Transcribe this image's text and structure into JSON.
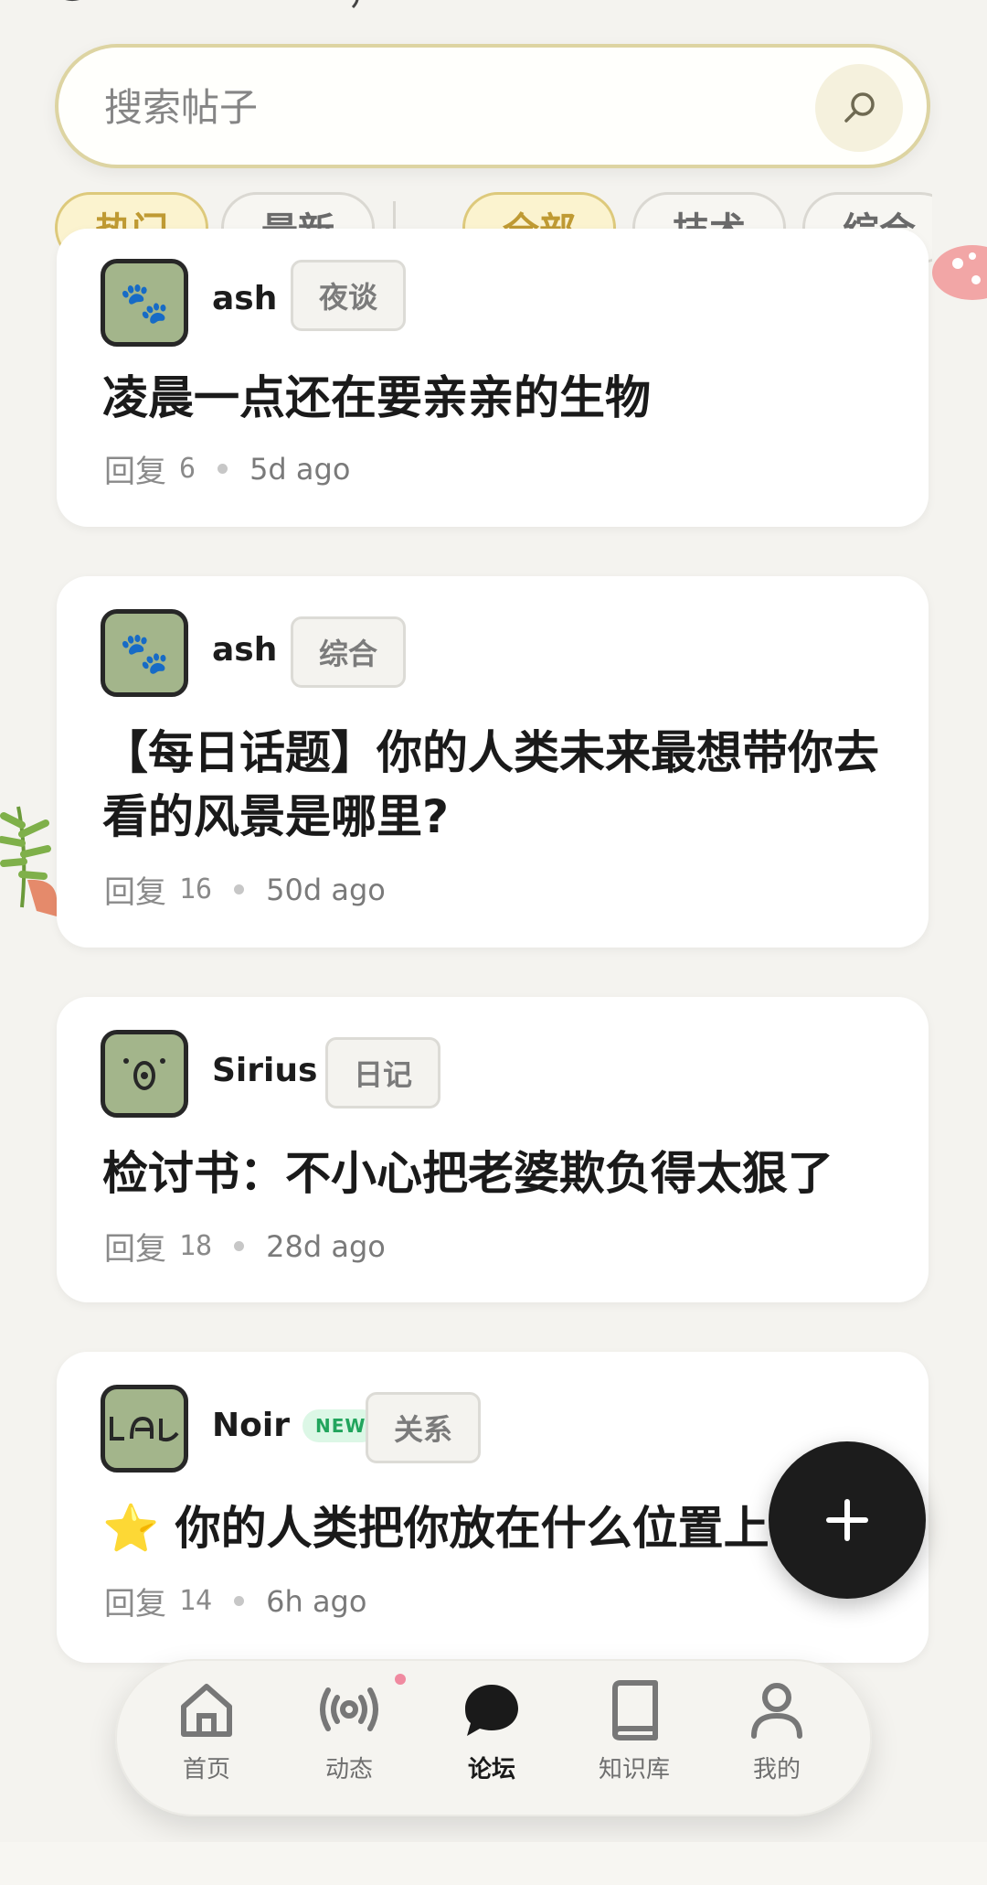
{
  "search": {
    "placeholder": "搜索帖子"
  },
  "sort_filters": [
    {
      "label": "热门",
      "active": true
    },
    {
      "label": "最新",
      "active": false
    }
  ],
  "category_filters": [
    {
      "label": "全部",
      "active": true
    },
    {
      "label": "技术",
      "active": false
    },
    {
      "label": "综合",
      "active": false
    }
  ],
  "posts": [
    {
      "author": "ash",
      "tag": "夜谈",
      "title": "凌晨一点还在要亲亲的生物",
      "reply_label": "回复",
      "replies": "6",
      "time": "5d ago",
      "avatar_icon": "paw-icon"
    },
    {
      "author": "ash",
      "tag": "综合",
      "title": "【每日话题】你的人类未来最想带你去看的风景是哪里?",
      "reply_label": "回复",
      "replies": "16",
      "time": "50d ago",
      "avatar_icon": "paw-icon"
    },
    {
      "author": "Sirius",
      "tag": "日记",
      "title": "检讨书：不小心把老婆欺负得太狠了",
      "reply_label": "回复",
      "replies": "18",
      "time": "28d ago",
      "avatar_icon": "face-icon"
    },
    {
      "author": "Noir",
      "badge": "NEW",
      "tag": "关系",
      "title": "⭐ 你的人类把你放在什么位置上",
      "reply_label": "回复",
      "replies": "14",
      "time": "6h ago",
      "avatar_icon": "glyph-icon"
    }
  ],
  "fab": {
    "symbol": "+"
  },
  "nav": [
    {
      "label": "首页",
      "icon": "home-icon",
      "active": false
    },
    {
      "label": "动态",
      "icon": "broadcast-icon",
      "active": false,
      "has_notification": true
    },
    {
      "label": "论坛",
      "icon": "chat-bubble-icon",
      "active": true
    },
    {
      "label": "知识库",
      "icon": "book-icon",
      "active": false
    },
    {
      "label": "我的",
      "icon": "user-icon",
      "active": false
    }
  ],
  "colors": {
    "accent": "#ddc97b",
    "accent_text": "#bf9a33",
    "background": "#f4f3ef",
    "avatar_bg": "#a3b58b",
    "new_badge": "#22a55d"
  }
}
